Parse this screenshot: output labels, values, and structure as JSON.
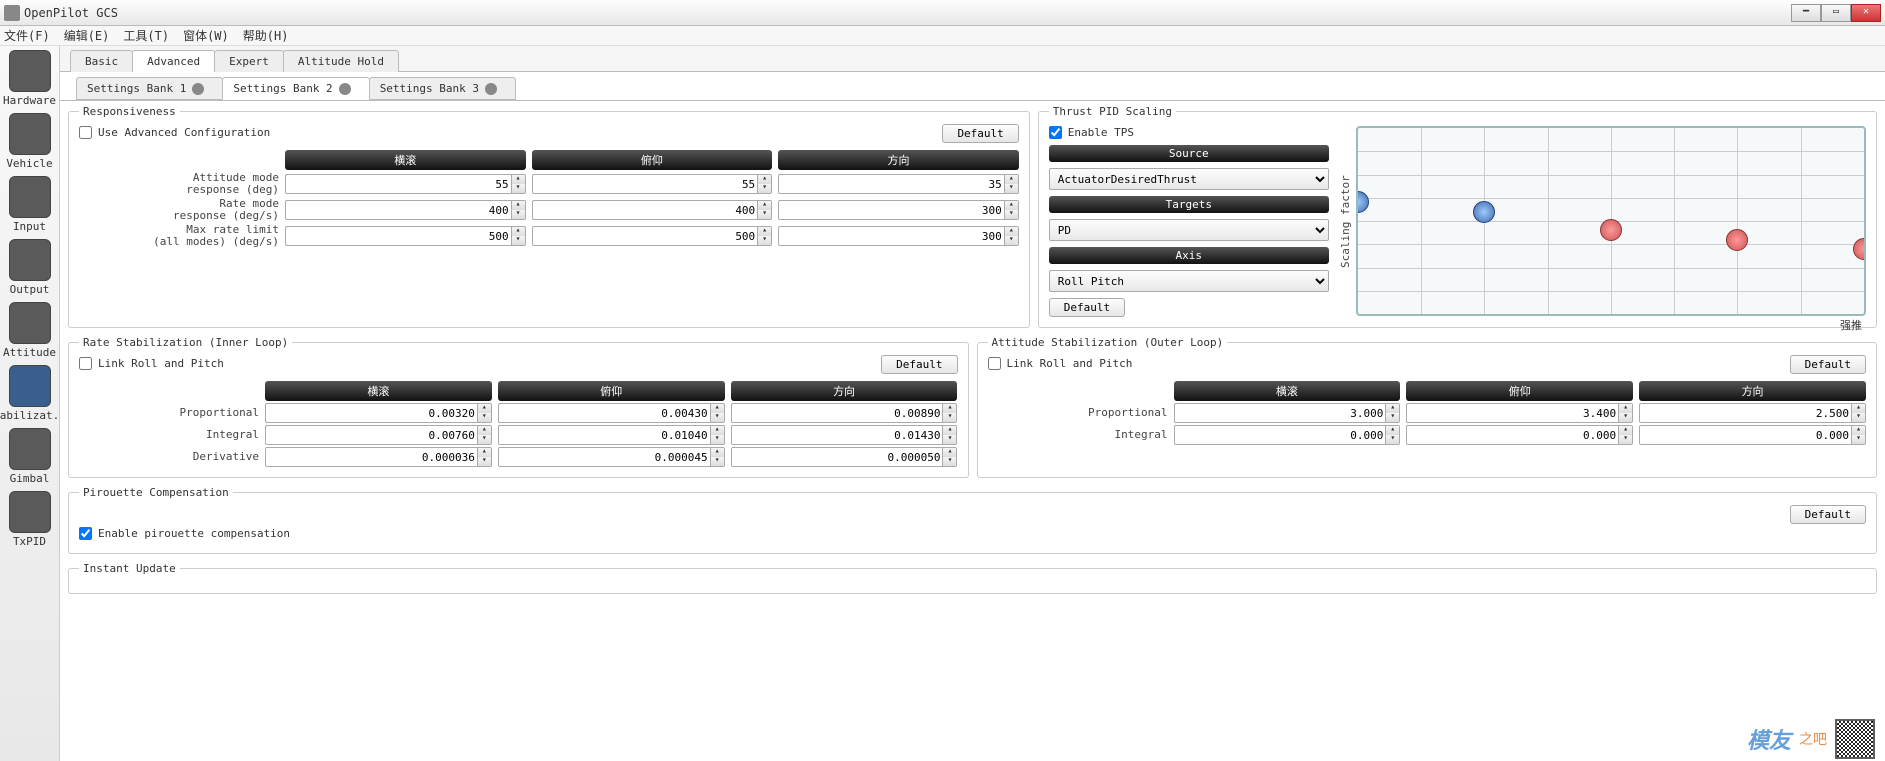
{
  "window": {
    "title": "OpenPilot GCS"
  },
  "menubar": [
    "文件(F)",
    "编辑(E)",
    "工具(T)",
    "窗体(W)",
    "帮助(H)"
  ],
  "sidebar": [
    {
      "label": "Hardware"
    },
    {
      "label": "Vehicle"
    },
    {
      "label": "Input"
    },
    {
      "label": "Output"
    },
    {
      "label": "Attitude"
    },
    {
      "label": "Stabilizat..."
    },
    {
      "label": "Gimbal"
    },
    {
      "label": "TxPID"
    }
  ],
  "tabs": [
    "Basic",
    "Advanced",
    "Expert",
    "Altitude Hold"
  ],
  "subtabs": [
    "Settings Bank 1",
    "Settings Bank 2",
    "Settings Bank 3"
  ],
  "common": {
    "default": "Default"
  },
  "responsiveness": {
    "title": "Responsiveness",
    "use_adv": "Use Advanced Configuration",
    "cols": [
      "横滚",
      "俯仰",
      "方向"
    ],
    "rows": [
      {
        "label": "Attitude mode\nresponse (deg)",
        "vals": [
          "55",
          "55",
          "35"
        ]
      },
      {
        "label": "Rate mode\nresponse (deg/s)",
        "vals": [
          "400",
          "400",
          "300"
        ]
      },
      {
        "label": "Max rate limit\n(all modes) (deg/s)",
        "vals": [
          "500",
          "500",
          "300"
        ]
      }
    ]
  },
  "tps": {
    "title": "Thrust PID Scaling",
    "enable": "Enable TPS",
    "source_h": "Source",
    "source": "ActuatorDesiredThrust",
    "targets_h": "Targets",
    "targets": "PD",
    "axis_h": "Axis",
    "axis": "Roll Pitch",
    "graph": {
      "ylabel": "Scaling factor",
      "xlabel": "强推"
    }
  },
  "rate": {
    "title": "Rate Stabilization (Inner Loop)",
    "link": "Link Roll and Pitch",
    "cols": [
      "横滚",
      "俯仰",
      "方向"
    ],
    "rows": [
      {
        "label": "Proportional",
        "vals": [
          "0.00320",
          "0.00430",
          "0.00890"
        ]
      },
      {
        "label": "Integral",
        "vals": [
          "0.00760",
          "0.01040",
          "0.01430"
        ]
      },
      {
        "label": "Derivative",
        "vals": [
          "0.000036",
          "0.000045",
          "0.000050"
        ]
      }
    ]
  },
  "attitude": {
    "title": "Attitude Stabilization (Outer Loop)",
    "link": "Link Roll and Pitch",
    "cols": [
      "横滚",
      "俯仰",
      "方向"
    ],
    "rows": [
      {
        "label": "Proportional",
        "vals": [
          "3.000",
          "3.400",
          "2.500"
        ]
      },
      {
        "label": "Integral",
        "vals": [
          "0.000",
          "0.000",
          "0.000"
        ]
      }
    ]
  },
  "pirouette": {
    "title": "Pirouette Compensation",
    "enable": "Enable pirouette compensation"
  },
  "instant": {
    "title": "Instant Update"
  },
  "brand": {
    "logo": "模友",
    "sub": "之吧"
  },
  "chart_data": {
    "type": "line",
    "title": "Thrust PID Scaling",
    "xlabel": "强推",
    "ylabel": "Scaling factor",
    "x": [
      0.0,
      0.25,
      0.5,
      0.75,
      1.0
    ],
    "values": [
      0.1,
      0.05,
      -0.05,
      -0.1,
      -0.15
    ],
    "ylim": [
      -0.5,
      0.5
    ]
  }
}
